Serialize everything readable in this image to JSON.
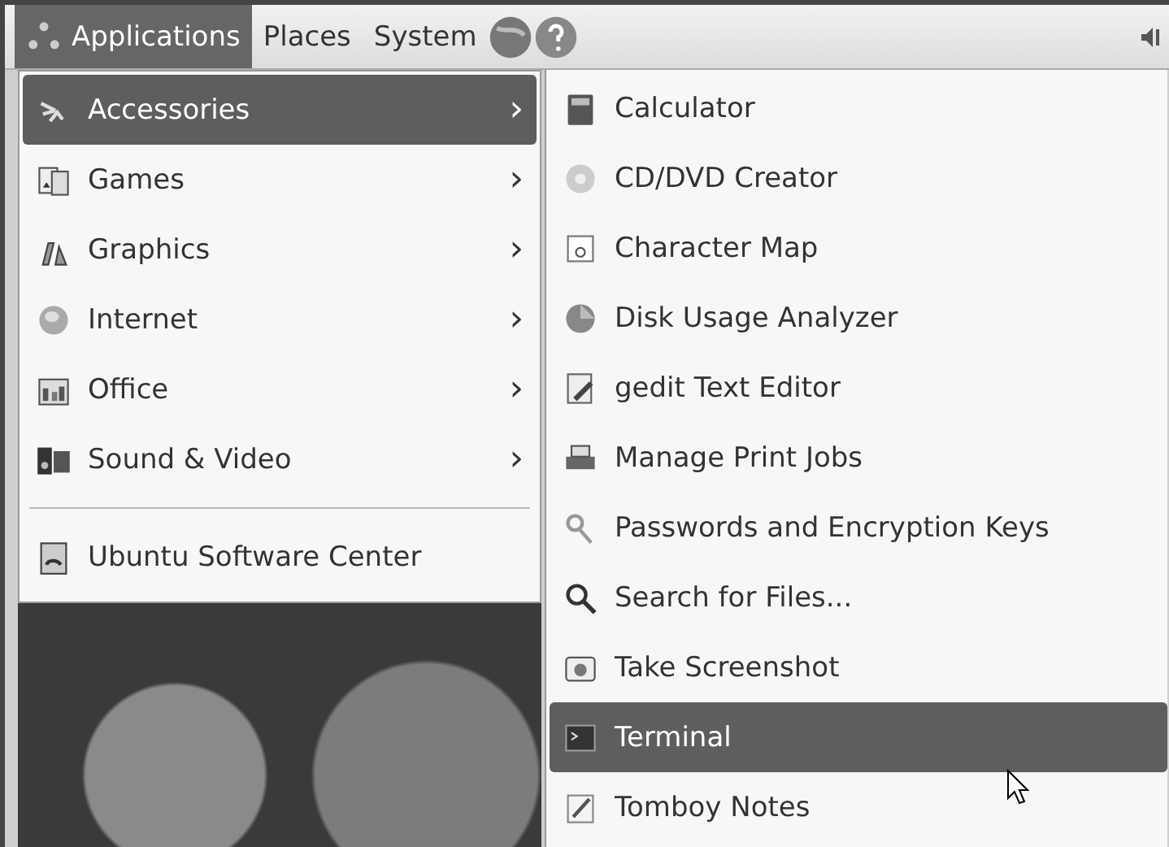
{
  "panel": {
    "menus": [
      {
        "label": "Applications",
        "selected": true
      },
      {
        "label": "Places",
        "selected": false
      },
      {
        "label": "System",
        "selected": false
      }
    ]
  },
  "applications_menu": {
    "items": [
      {
        "kind": "item",
        "label": "Accessories",
        "arrow": "›",
        "selected": true
      },
      {
        "kind": "item",
        "label": "Games",
        "arrow": "›",
        "selected": false
      },
      {
        "kind": "item",
        "label": "Graphics",
        "arrow": "›",
        "selected": false
      },
      {
        "kind": "item",
        "label": "Internet",
        "arrow": "›",
        "selected": false
      },
      {
        "kind": "item",
        "label": "Office",
        "arrow": "›",
        "selected": false
      },
      {
        "kind": "item",
        "label": "Sound & Video",
        "arrow": "›",
        "selected": false
      },
      {
        "kind": "separator"
      },
      {
        "kind": "item",
        "label": "Ubuntu Software Center",
        "selected": false
      }
    ]
  },
  "accessories_menu": {
    "items": [
      {
        "label": "Calculator",
        "selected": false
      },
      {
        "label": "CD/DVD Creator",
        "selected": false
      },
      {
        "label": "Character Map",
        "selected": false
      },
      {
        "label": "Disk Usage Analyzer",
        "selected": false
      },
      {
        "label": "gedit Text Editor",
        "selected": false
      },
      {
        "label": "Manage Print Jobs",
        "selected": false
      },
      {
        "label": "Passwords and Encryption Keys",
        "selected": false
      },
      {
        "label": "Search for Files...",
        "selected": false
      },
      {
        "label": "Take Screenshot",
        "selected": false
      },
      {
        "label": "Terminal",
        "selected": true
      },
      {
        "label": "Tomboy Notes",
        "selected": false
      }
    ]
  }
}
